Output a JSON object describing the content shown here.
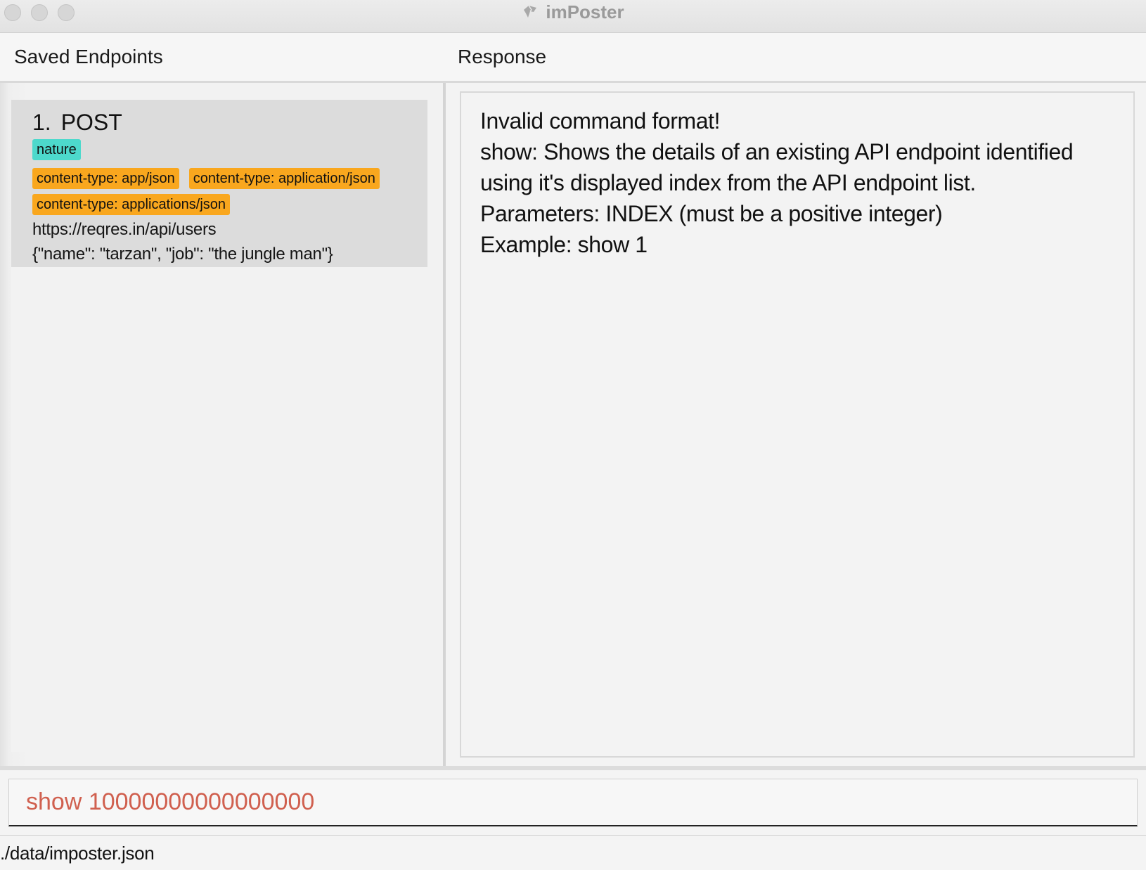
{
  "window": {
    "title": "imPoster"
  },
  "headers": {
    "left": "Saved Endpoints",
    "right": "Response"
  },
  "endpoints": [
    {
      "index": "1.",
      "method": "POST",
      "tags": [
        {
          "label": "nature",
          "color": "#4dd9cc"
        }
      ],
      "headers": [
        {
          "label": "content-type: app/json",
          "color": "#f9a71e"
        },
        {
          "label": "content-type: application/json",
          "color": "#f9a71e"
        },
        {
          "label": "content-type: applications/json",
          "color": "#f9a71e"
        }
      ],
      "url": "https://reqres.in/api/users",
      "body": "{\"name\": \"tarzan\", \"job\": \"the jungle man\"}"
    }
  ],
  "response": {
    "lines": [
      "Invalid command format!",
      "show: Shows the details of an existing API endpoint identified",
      "using it's displayed index from the API endpoint list.",
      "Parameters: INDEX (must be a positive integer)",
      "Example: show 1"
    ]
  },
  "command": {
    "value": "show 10000000000000000",
    "color": "#d0604f"
  },
  "status": {
    "path": "./data/imposter.json"
  }
}
